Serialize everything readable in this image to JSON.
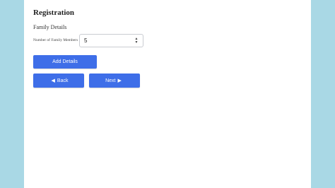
{
  "form": {
    "title": "Registration",
    "section": "Family Details",
    "family_members_label": "Number of Family Members",
    "family_members_value": "5"
  },
  "buttons": {
    "add_details": "Add Details",
    "back": "Back",
    "next": "Next"
  },
  "icons": {
    "back": "arrow-left-icon",
    "next": "arrow-right-icon",
    "spinner": "spinner-arrows-icon"
  },
  "colors": {
    "background": "#a9d8e5",
    "card": "#ffffff",
    "button": "#3e6ee8"
  }
}
